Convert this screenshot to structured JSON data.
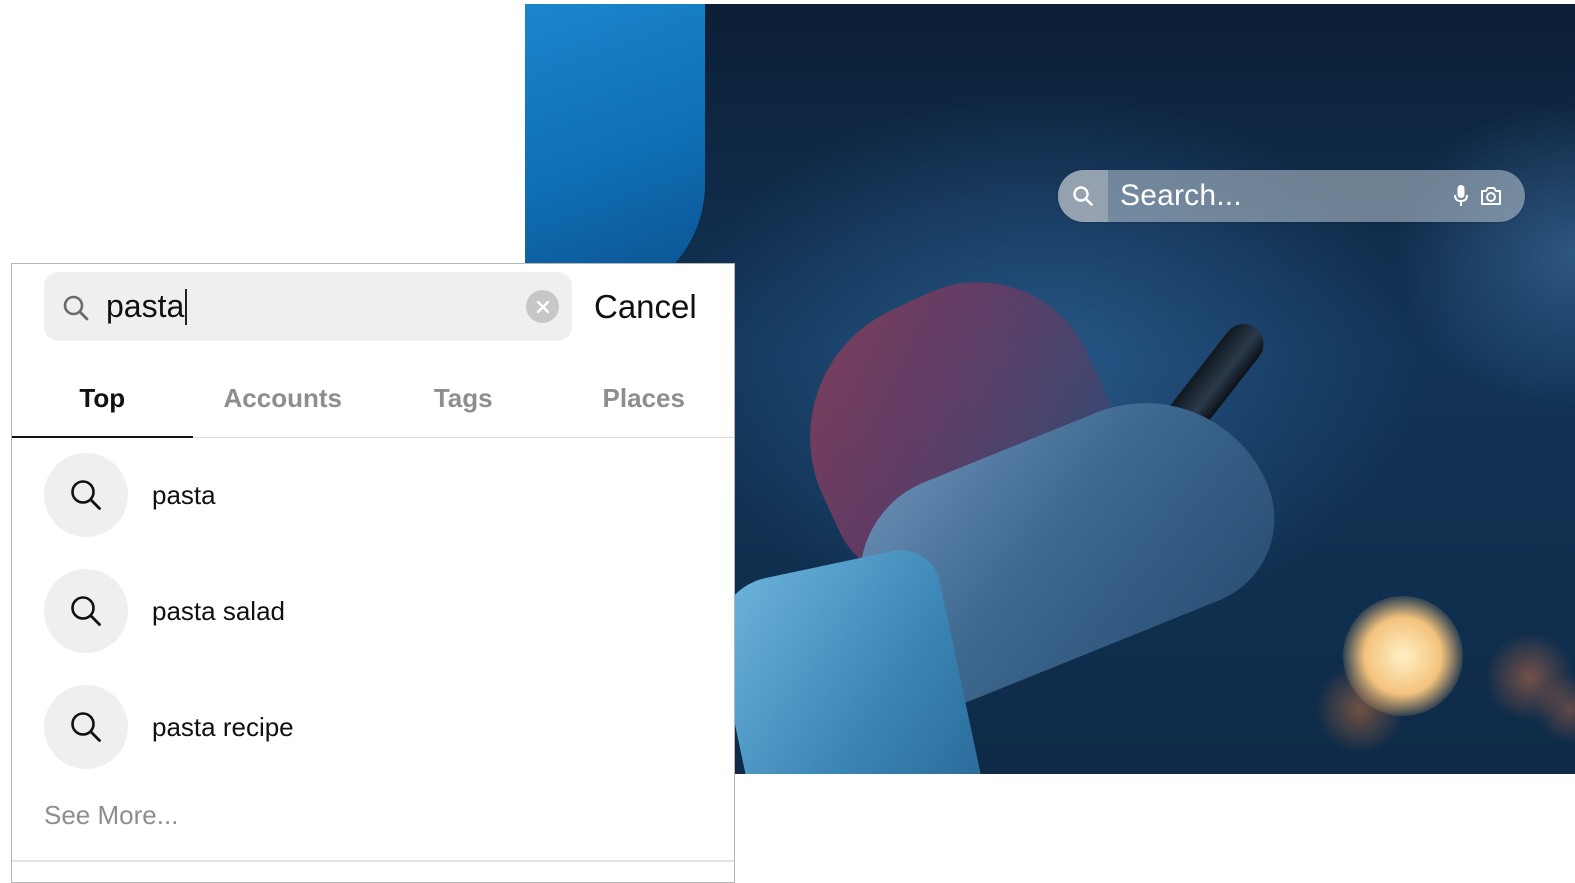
{
  "overlay_search": {
    "placeholder": "Search...",
    "icons": [
      "search-icon",
      "microphone-icon",
      "camera-icon"
    ]
  },
  "search": {
    "query": "pasta",
    "cancel_label": "Cancel",
    "icons": [
      "search-icon",
      "clear-icon"
    ]
  },
  "tabs": [
    {
      "label": "Top",
      "active": true
    },
    {
      "label": "Accounts",
      "active": false
    },
    {
      "label": "Tags",
      "active": false
    },
    {
      "label": "Places",
      "active": false
    }
  ],
  "results": [
    {
      "label": "pasta",
      "icon": "search-icon"
    },
    {
      "label": "pasta salad",
      "icon": "search-icon"
    },
    {
      "label": "pasta recipe",
      "icon": "search-icon"
    }
  ],
  "see_more_label": "See More...",
  "colors": {
    "field_bg": "#efefef",
    "text": "#111111",
    "muted": "#8e8e8e",
    "photo_blue": "#123457"
  }
}
